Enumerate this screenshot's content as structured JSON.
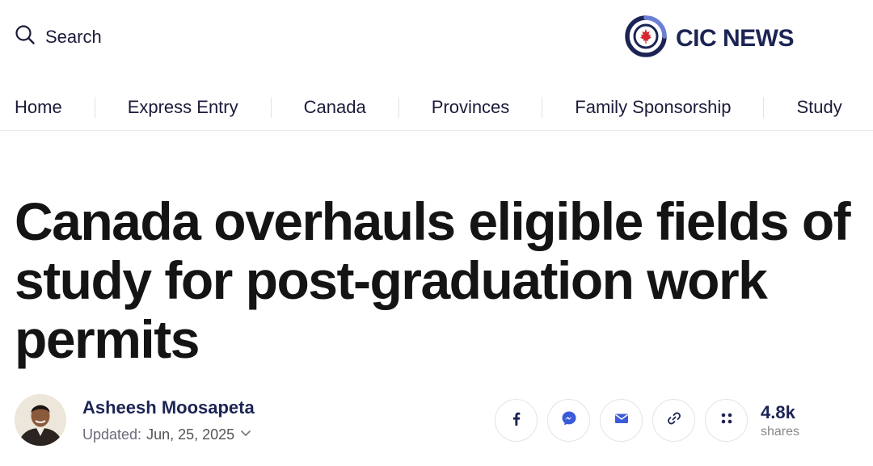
{
  "header": {
    "search_label": "Search",
    "logo_text": "CIC NEWS",
    "brand_color": "#1c2454",
    "accent_color": "#d7282f"
  },
  "nav": {
    "items": [
      {
        "label": "Home"
      },
      {
        "label": "Express Entry"
      },
      {
        "label": "Canada"
      },
      {
        "label": "Provinces"
      },
      {
        "label": "Family Sponsorship"
      },
      {
        "label": "Study"
      }
    ]
  },
  "article": {
    "title": "Canada overhauls eligible fields of study for post-graduation work permits",
    "author": "Asheesh Moosapeta",
    "updated_label": "Updated:",
    "updated_date": "Jun, 25, 2025"
  },
  "share": {
    "buttons": [
      {
        "icon": "facebook-icon"
      },
      {
        "icon": "messenger-icon"
      },
      {
        "icon": "email-icon"
      },
      {
        "icon": "link-icon"
      },
      {
        "icon": "more-icon"
      }
    ],
    "count": "4.8k",
    "count_label": "shares"
  }
}
